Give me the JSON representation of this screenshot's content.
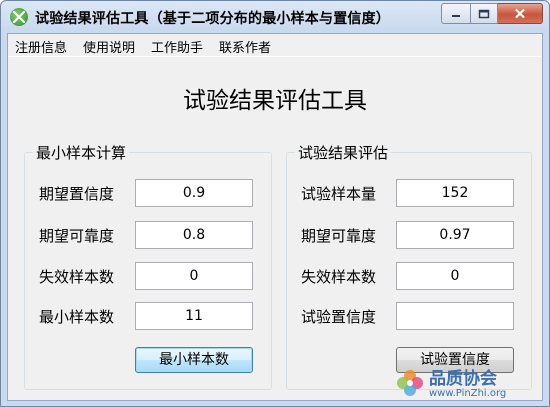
{
  "window": {
    "title": "试验结果评估工具（基于二项分布的最小样本与置信度）"
  },
  "menu": [
    "注册信息",
    "使用说明",
    "工作助手",
    "联系作者"
  ],
  "main_title": "试验结果评估工具",
  "min_sample_group": {
    "label": "最小样本计算",
    "rows": [
      {
        "label": "期望置信度",
        "value": "0.9"
      },
      {
        "label": "期望可靠度",
        "value": "0.8"
      },
      {
        "label": "失效样本数",
        "value": "0"
      },
      {
        "label": "最小样本数",
        "value": "11"
      }
    ],
    "button_label": "最小样本数"
  },
  "eval_group": {
    "label": "试验结果评估",
    "rows": [
      {
        "label": "试验样本量",
        "value": "152"
      },
      {
        "label": "期望可靠度",
        "value": "0.97"
      },
      {
        "label": "失效样本数",
        "value": "0"
      },
      {
        "label": "试验置信度",
        "value": ""
      }
    ],
    "button_label": "试验置信度"
  },
  "watermark": {
    "name": "品质协会",
    "url": "www.PinZhi.org"
  }
}
